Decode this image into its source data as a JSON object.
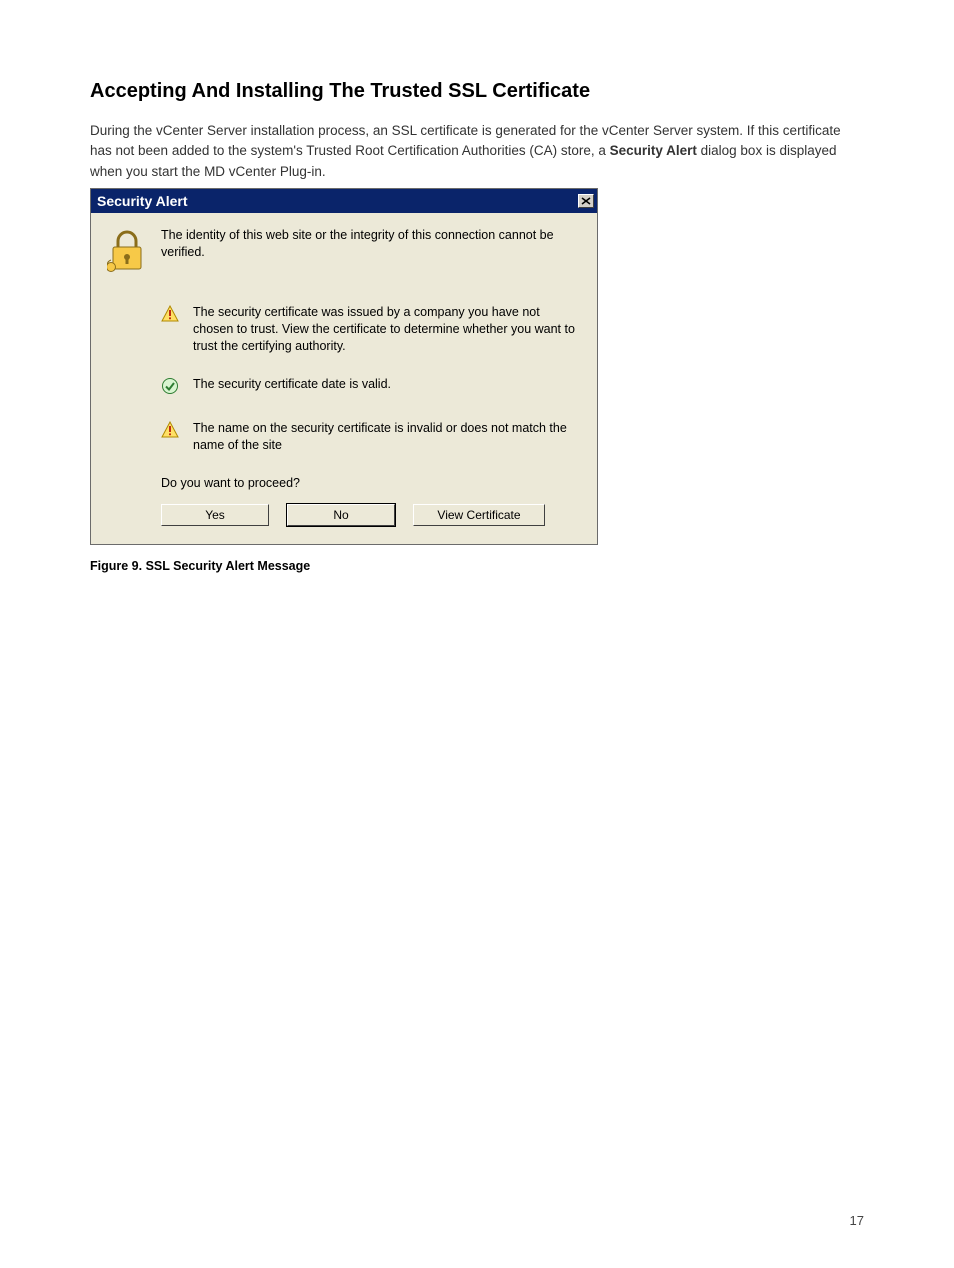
{
  "heading": "Accepting And Installing The Trusted SSL Certificate",
  "paragraph": "During the vCenter Server installation process, an SSL certificate is generated for the vCenter Server system. If this certificate has not been added to the system's Trusted Root Certification Authorities (CA) store, a Security Alert dialog box is displayed when you start the MD vCenter Plug-in.",
  "paragraph_bold": "Security Alert",
  "dialog": {
    "title": "Security Alert",
    "intro": "The identity of this web site or the integrity of this connection cannot be verified.",
    "items": [
      "The security certificate was issued by a company you have not chosen to trust. View the certificate to determine whether you want to trust the certifying authority.",
      "The security certificate date is valid.",
      "The name on the security certificate is invalid or does not match the name of the site"
    ],
    "prompt": "Do you want to proceed?",
    "buttons": {
      "yes": "Yes",
      "no": "No",
      "view": "View Certificate"
    }
  },
  "caption": "Figure 9. SSL Security Alert Message",
  "pagenum": "17"
}
